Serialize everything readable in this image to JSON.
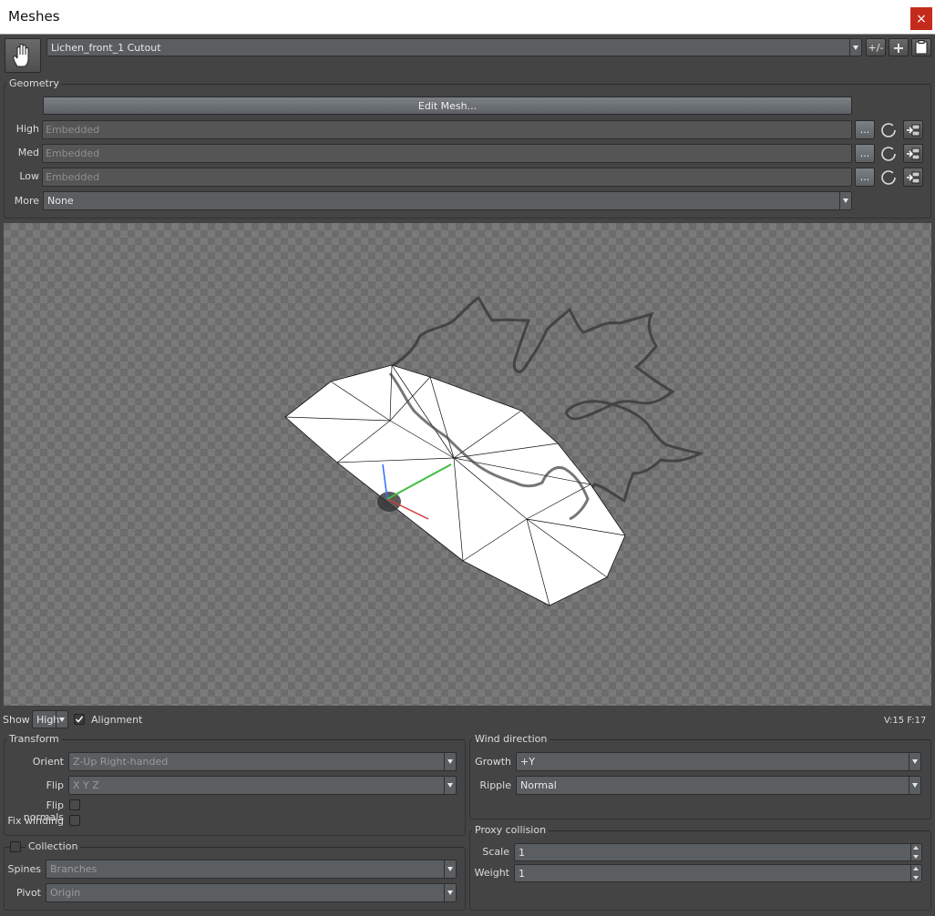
{
  "window": {
    "title": "Meshes",
    "close": "×"
  },
  "toolbar": {
    "mesh_select": "Lichen_front_1 Cutout",
    "plus_minus": "+/-",
    "add": "+"
  },
  "geometry": {
    "group_label": "Geometry",
    "edit_mesh": "Edit Mesh...",
    "rows": [
      {
        "label": "High",
        "value": "Embedded",
        "browse": "..."
      },
      {
        "label": "Med",
        "value": "Embedded",
        "browse": "..."
      },
      {
        "label": "Low",
        "value": "Embedded",
        "browse": "..."
      }
    ],
    "more_label": "More",
    "more_value": "None"
  },
  "viewport_bar": {
    "show_label": "Show",
    "show_value": "High",
    "alignment_label": "Alignment",
    "stats": "V:15  F:17"
  },
  "transform": {
    "group_label": "Transform",
    "orient_label": "Orient",
    "orient_value": "Z-Up Right-handed",
    "flip_label": "Flip",
    "flip_value": "X Y Z",
    "flip_normals_label": "Flip normals",
    "fix_winding_label": "Fix winding"
  },
  "collection": {
    "group_label": "Collection",
    "spines_label": "Spines",
    "spines_value": "Branches",
    "pivot_label": "Pivot",
    "pivot_value": "Origin"
  },
  "wind": {
    "group_label": "Wind direction",
    "growth_label": "Growth",
    "growth_value": "+Y",
    "ripple_label": "Ripple",
    "ripple_value": "Normal"
  },
  "proxy": {
    "group_label": "Proxy collision",
    "scale_label": "Scale",
    "scale_value": "1",
    "weight_label": "Weight",
    "weight_value": "1"
  },
  "colors": {
    "close_red": "#c42b1c",
    "panel": "#444444",
    "field": "#5a5e61"
  }
}
